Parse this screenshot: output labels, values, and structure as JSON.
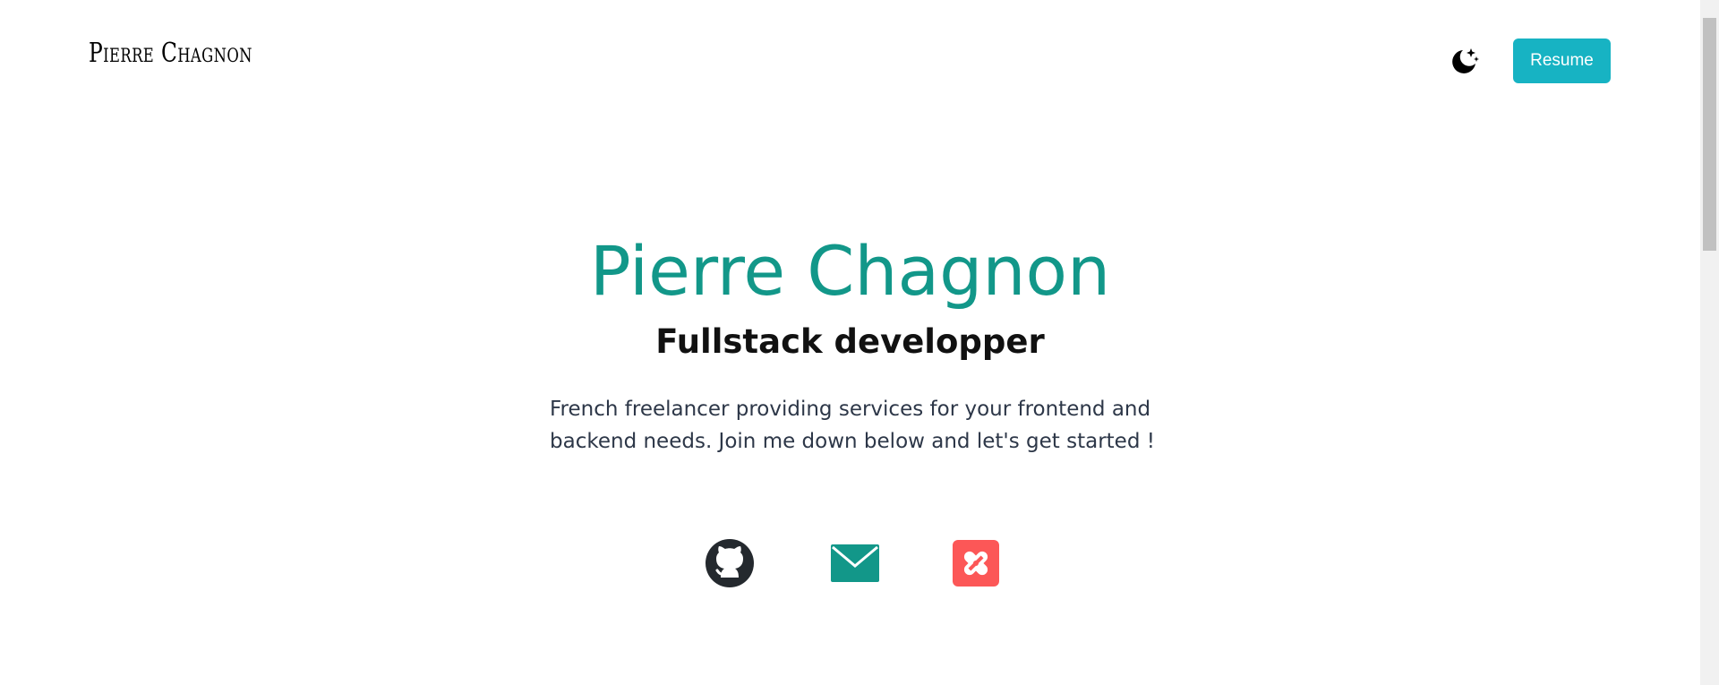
{
  "header": {
    "logo_text": "Pierre Chagnon",
    "theme_toggle_icon": "moon-stars-icon",
    "resume_label": "Resume"
  },
  "hero": {
    "title": "Pierre Chagnon",
    "subtitle": "Fullstack developper",
    "description": "French freelancer providing services for your frontend and backend needs. Join me down below and let's get started !"
  },
  "social": [
    {
      "name": "github",
      "icon": "github-icon"
    },
    {
      "name": "email",
      "icon": "mail-icon"
    },
    {
      "name": "malt",
      "icon": "malt-icon"
    }
  ],
  "colors": {
    "accent": "#129789",
    "button": "#17b3c3",
    "github": "#24292e",
    "mail": "#129789",
    "malt": "#fc5757",
    "text": "#2d3748"
  }
}
